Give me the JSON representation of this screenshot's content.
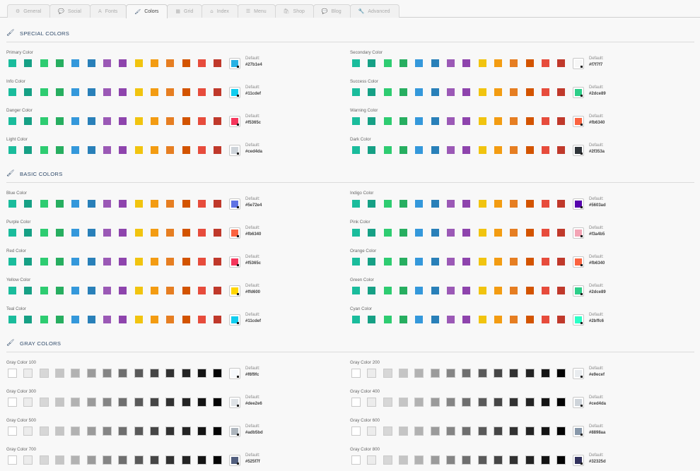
{
  "tabs": [
    {
      "label": "General",
      "icon": "⚙",
      "icon_name": "gear-icon",
      "active": false
    },
    {
      "label": "Social",
      "icon": "💬",
      "icon_name": "chat-icon",
      "active": false
    },
    {
      "label": "Fonts",
      "icon": "A",
      "icon_name": "font-icon",
      "active": false
    },
    {
      "label": "Colors",
      "icon": "🖌",
      "icon_name": "brush-icon",
      "active": true
    },
    {
      "label": "Grid",
      "icon": "▦",
      "icon_name": "grid-icon",
      "active": false
    },
    {
      "label": "Index",
      "icon": "⌂",
      "icon_name": "home-icon",
      "active": false
    },
    {
      "label": "Menu",
      "icon": "☰",
      "icon_name": "menu-icon",
      "active": false
    },
    {
      "label": "Shop",
      "icon": "🛍",
      "icon_name": "shop-bag-icon",
      "active": false
    },
    {
      "label": "Blog",
      "icon": "💬",
      "icon_name": "comment-icon",
      "active": false
    },
    {
      "label": "Advanced",
      "icon": "🔧",
      "icon_name": "wrench-icon",
      "active": false
    }
  ],
  "palettes": {
    "color": [
      "#1abc9c",
      "#16a085",
      "#2ecc71",
      "#27ae60",
      "#3498db",
      "#2980b9",
      "#9b59b6",
      "#8e44ad",
      "#f1c40f",
      "#f39c12",
      "#e67e22",
      "#d35400",
      "#e74c3c",
      "#c0392b"
    ],
    "gray": [
      "#ffffff",
      "#ececec",
      "#d7d7d7",
      "#c5c5c5",
      "#b2b2b2",
      "#9b9b9b",
      "#858585",
      "#6f6f6f",
      "#5a5a5a",
      "#464646",
      "#323232",
      "#242424",
      "#141414",
      "#050505"
    ]
  },
  "default_label": "Default:",
  "sections": [
    {
      "title": "SPECIAL COLORS",
      "palette": "color",
      "rows": [
        [
          {
            "label": "Primary Color",
            "value": "#27b1e4"
          },
          {
            "label": "Secondary Color",
            "value": "#f7f7f7"
          }
        ],
        [
          {
            "label": "Info Color",
            "value": "#11cdef"
          },
          {
            "label": "Success Color",
            "value": "#2dce89"
          }
        ],
        [
          {
            "label": "Danger Color",
            "value": "#f5365c"
          },
          {
            "label": "Warning Color",
            "value": "#fb6340"
          }
        ],
        [
          {
            "label": "Light Color",
            "value": "#ced4da"
          },
          {
            "label": "Dark Color",
            "value": "#2f353a"
          }
        ]
      ]
    },
    {
      "title": "BASIC COLORS",
      "palette": "color",
      "rows": [
        [
          {
            "label": "Blue Color",
            "value": "#5e72e4"
          },
          {
            "label": "Indigo Color",
            "value": "#5603ad"
          }
        ],
        [
          {
            "label": "Purple Color",
            "value": "#fb6340"
          },
          {
            "label": "Pink Color",
            "value": "#f3a4b5"
          }
        ],
        [
          {
            "label": "Red Color",
            "value": "#f5365c"
          },
          {
            "label": "Orange Color",
            "value": "#fb6340"
          }
        ],
        [
          {
            "label": "Yellow Color",
            "value": "#ffd600"
          },
          {
            "label": "Green Color",
            "value": "#2dce89"
          }
        ],
        [
          {
            "label": "Teal Color",
            "value": "#11cdef"
          },
          {
            "label": "Cyan Color",
            "value": "#2bffc6"
          }
        ]
      ]
    },
    {
      "title": "GRAY COLORS",
      "palette": "gray",
      "rows": [
        [
          {
            "label": "Gray Color 100",
            "value": "#f6f9fc"
          },
          {
            "label": "Gray Color 200",
            "value": "#e9ecef"
          }
        ],
        [
          {
            "label": "Gray Color 300",
            "value": "#dee2e6"
          },
          {
            "label": "Gray Color 400",
            "value": "#ced4da"
          }
        ],
        [
          {
            "label": "Gray Color 500",
            "value": "#adb5bd"
          },
          {
            "label": "Gray Color 600",
            "value": "#8898aa"
          }
        ],
        [
          {
            "label": "Gray Color 700",
            "value": "#525f7f"
          },
          {
            "label": "Gray Color 800",
            "value": "#32325d"
          }
        ]
      ]
    }
  ]
}
